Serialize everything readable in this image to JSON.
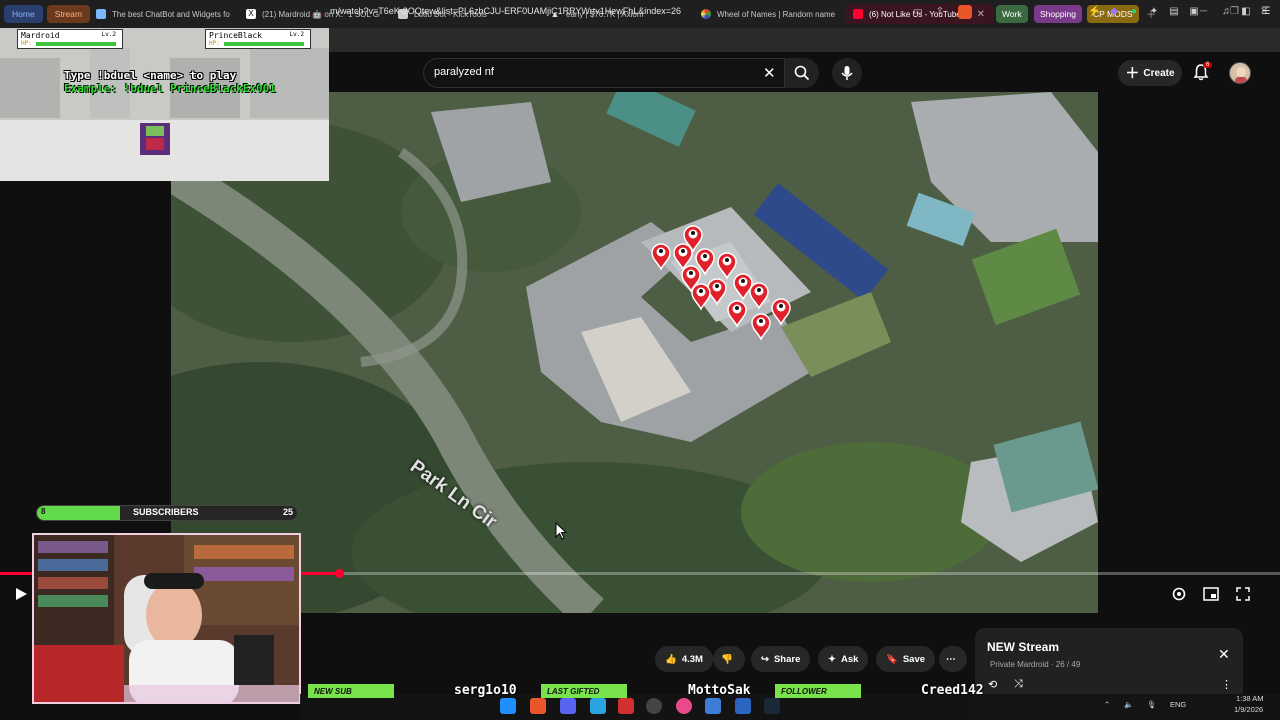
{
  "browser": {
    "pill_tabs": [
      "Home",
      "Stream"
    ],
    "tabs": [
      {
        "title": "The best ChatBot and Widgets fo",
        "color": "#7ab7ff"
      },
      {
        "title": "(21) Mardroid 🤖 on X: \"1 SOL GI",
        "color": "#ffffff"
      },
      {
        "title": "Lotto Bot - KickTools",
        "color": "#cccccc"
      },
      {
        "title": "early | $76.7K | Axiom",
        "color": "#dddddd"
      },
      {
        "title": "Wheel of Names | Random name",
        "color": "#33aa66"
      },
      {
        "title": "(6) Not Like Us - YouTube",
        "color": "#ff0033",
        "active": true
      }
    ],
    "groups": [
      {
        "label": "Work",
        "color": "#3b6a40"
      },
      {
        "label": "Shopping",
        "color": "#7a3a8a"
      },
      {
        "label": "CP MODS",
        "color": "#8a6a10"
      }
    ],
    "url": "m/watch?v=T6eK-2OQtew&list=PL6zbCJU-ERF0UAMjiC1RRYWrtv1HewFhL&index=26"
  },
  "youtube": {
    "search_value": "paralyzed nf",
    "create_label": "Create",
    "notification_count": "6"
  },
  "video": {
    "street_label": "Park Ln Cir",
    "progress_fraction": 0.265,
    "buffered_fraction": 0.6
  },
  "game": {
    "player1": {
      "name": "Mardroid",
      "level": "Lv.2",
      "hp_label": "HP:"
    },
    "player2": {
      "name": "PrinceBlack",
      "level": "Lv.2",
      "hp_label": "HP:"
    },
    "line1": "Type !bduel <name> to play",
    "line2": "Example: !bduel PrinceBlackEx001"
  },
  "subs_goal": {
    "label": "SUBSCRIBERS",
    "current": "8",
    "goal": "25",
    "fraction": 0.32
  },
  "actions": {
    "like_count": "4.3M",
    "share": "Share",
    "ask": "Ask",
    "save": "Save"
  },
  "playlist": {
    "title": "NEW Stream",
    "subtitle": "Private Mardroid · 26 / 49"
  },
  "alerts": [
    {
      "tag": "NEW SUB",
      "name": "serg1o10",
      "color": "#79e34b"
    },
    {
      "tag": "LAST GIFTED",
      "name": "MottoSak",
      "color": "#79e34b"
    },
    {
      "tag": "FOLLOWER",
      "name": "Creed142",
      "color": "#79e34b"
    }
  ],
  "tray": {
    "lang": "ENG",
    "time": "1:38 AM",
    "date": "1/9/2026"
  }
}
